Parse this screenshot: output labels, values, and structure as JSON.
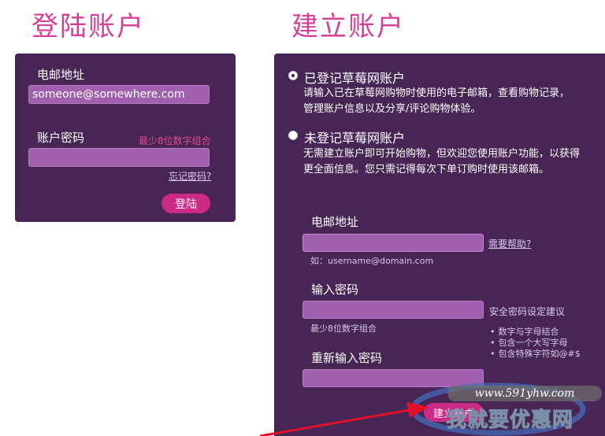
{
  "login": {
    "heading": "登陆账户",
    "email_label": "电邮地址",
    "email_value": "someone@somewhere.com",
    "password_label": "账户密码",
    "password_rule": "最少8位数字组合",
    "forgot_link": "忘记密码?",
    "submit_label": "登陆"
  },
  "register": {
    "heading": "建立账户",
    "option_registered": {
      "title": "已登记草莓网账户",
      "description": "请输入已在草莓网购物时使用的电子邮箱，查看购物记录，管理账户信息以及分享/评论购物体验。",
      "selected": true
    },
    "option_unregistered": {
      "title": "未登记草莓网账户",
      "description": "无需建立账户即可开始购物，但欢迎您使用账户功能，以获得更全面信息。您只需记得每次下单订购时使用该邮箱。",
      "selected": false
    },
    "email_label": "电邮地址",
    "help_link": "需要帮助?",
    "email_example": "如：username@domain.com",
    "password_label": "输入密码",
    "password_rule": "最少8位数字组合",
    "password_tips_title": "安全密码设定建议",
    "password_tips": [
      "数字与字母结合",
      "包含一个大写字母",
      "包含特殊字符如@#$"
    ],
    "confirm_label": "重新输入密码",
    "submit_label": "建立账户"
  },
  "watermark": {
    "url": "www.591yhw.com",
    "brand": "我就要优惠网"
  },
  "colors": {
    "panel": "#472554",
    "heading": "#d43f98",
    "input": "#a060ae",
    "button": "#cc2a87",
    "arrow": "#e0102a"
  }
}
